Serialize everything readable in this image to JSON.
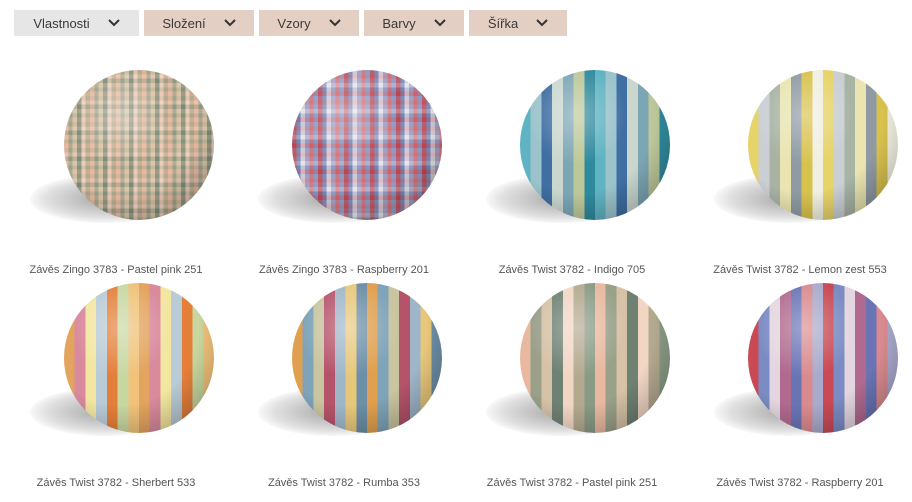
{
  "filters": [
    {
      "label": "Vlastnosti",
      "active": true
    },
    {
      "label": "Složení",
      "active": false
    },
    {
      "label": "Vzory",
      "active": false
    },
    {
      "label": "Barvy",
      "active": false
    },
    {
      "label": "Šířka",
      "active": false
    }
  ],
  "products": [
    {
      "name": "Závěs Zingo 3783 - Pastel pink 251",
      "pattern": "check",
      "colors": [
        "#e8b9a0",
        "#9aa08a",
        "#d9c7a8",
        "#7e8a78",
        "#f0d3bf",
        "#b7a98e"
      ]
    },
    {
      "name": "Závěs Zingo 3783 - Raspberry 201",
      "pattern": "check",
      "colors": [
        "#c0444f",
        "#6f86b8",
        "#e7e3ea",
        "#a7a4c6",
        "#d86e72",
        "#8c9bc6"
      ]
    },
    {
      "name": "Závěs Twist 3782 - Indigo 705",
      "pattern": "stripe",
      "colors": [
        "#5fb3c3",
        "#9cc3cc",
        "#3f6fa3",
        "#c9d7cf",
        "#7da6b5",
        "#bcc89a",
        "#2f8a9e"
      ]
    },
    {
      "name": "Závěs Twist 3782 - Lemon zest 553",
      "pattern": "stripe",
      "colors": [
        "#e6d36a",
        "#c9cfd3",
        "#a8b3a4",
        "#e9e4b0",
        "#8f9aa3",
        "#d8c24e",
        "#f1efe0"
      ]
    },
    {
      "name": "Závěs Twist 3782 - Sherbert 533",
      "pattern": "stripe",
      "colors": [
        "#e3a45f",
        "#d98a9d",
        "#f2e6a0",
        "#b9cbd6",
        "#e47f3a",
        "#c8d7a0",
        "#f0c27a"
      ]
    },
    {
      "name": "Závěs Twist 3782 - Rumba 353",
      "pattern": "stripe",
      "colors": [
        "#e0a04f",
        "#7fa3b8",
        "#c9c5a0",
        "#b5536a",
        "#9fb6c9",
        "#e7c77a",
        "#6c8ea6"
      ]
    },
    {
      "name": "Závěs Twist 3782 - Pastel pink 251",
      "pattern": "stripe",
      "colors": [
        "#e8b9a0",
        "#9aa08a",
        "#d6c2a6",
        "#6f8173",
        "#f1d6c4",
        "#b3a98f",
        "#8a9a86"
      ]
    },
    {
      "name": "Závěs Twist 3782 - Raspberry 201",
      "pattern": "stripe",
      "colors": [
        "#c94a55",
        "#7b8cc4",
        "#e4d6e0",
        "#b06a8f",
        "#6a74b5",
        "#d98a8f",
        "#a9a9cc"
      ]
    }
  ]
}
